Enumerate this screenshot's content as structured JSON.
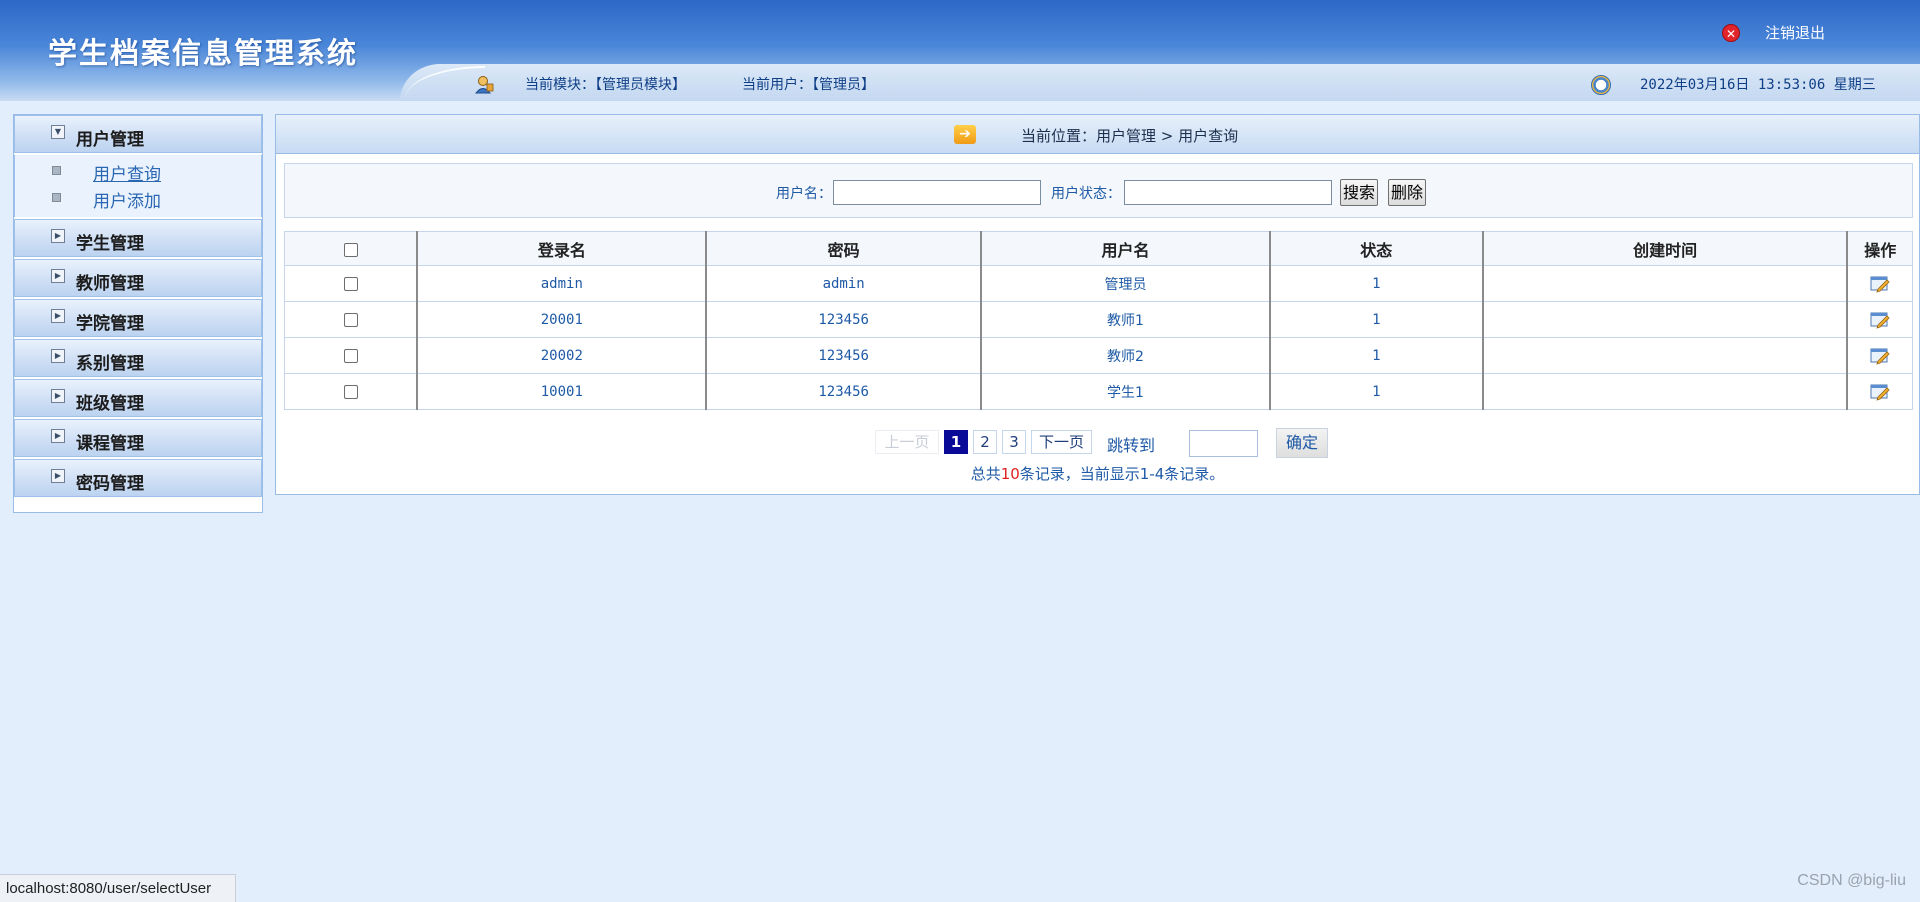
{
  "header": {
    "app_title": "学生档案信息管理系统",
    "logout_label": "注销退出",
    "module_text": "当前模块：【管理员模块】",
    "user_text": "当前用户：【管理员】",
    "datetime": "2022年03月16日 13:53:06 星期三"
  },
  "sidebar": {
    "groups": [
      {
        "label": "用户管理",
        "icon": "expanded-arrow-icon"
      },
      {
        "label": "学生管理",
        "icon": "collapsed-arrow-icon"
      },
      {
        "label": "教师管理",
        "icon": "collapsed-arrow-icon"
      },
      {
        "label": "学院管理",
        "icon": "collapsed-arrow-icon"
      },
      {
        "label": "系别管理",
        "icon": "collapsed-arrow-icon"
      },
      {
        "label": "班级管理",
        "icon": "collapsed-arrow-icon"
      },
      {
        "label": "课程管理",
        "icon": "collapsed-arrow-icon"
      },
      {
        "label": "密码管理",
        "icon": "collapsed-arrow-icon"
      }
    ],
    "sub_items": [
      "用户查询",
      "用户添加"
    ]
  },
  "main": {
    "location": "当前位置：用户管理 > 用户查询",
    "search": {
      "username_label": "用户名：",
      "username_value": "",
      "status_label": "用户状态：",
      "status_value": "",
      "search_button": "搜索",
      "delete_button": "删除"
    },
    "table": {
      "headers": [
        "登录名",
        "密码",
        "用户名",
        "状态",
        "创建时间",
        "操作"
      ],
      "rows": [
        [
          "admin",
          "admin",
          "管理员",
          "1",
          ""
        ],
        [
          "20001",
          "123456",
          "教师1",
          "1",
          ""
        ],
        [
          "20002",
          "123456",
          "教师2",
          "1",
          ""
        ],
        [
          "10001",
          "123456",
          "学生1",
          "1",
          ""
        ]
      ]
    },
    "pager": {
      "prev": "上一页",
      "pages": [
        "1",
        "2",
        "3"
      ],
      "next": "下一页",
      "jump_label": "跳转到",
      "jump_value": "",
      "confirm": "确定",
      "summary_prefix": "总共",
      "summary_total": "10",
      "summary_suffix": "条记录，当前显示1-4条记录。"
    }
  },
  "statusbar": {
    "url": "localhost:8080/user/selectUser"
  },
  "watermark": "CSDN @big-liu",
  "colors": {
    "header_blue": "#2d68c8",
    "link_blue": "#1f5aa6",
    "page_current": "#0a0a98",
    "background": "#e2eefb"
  }
}
